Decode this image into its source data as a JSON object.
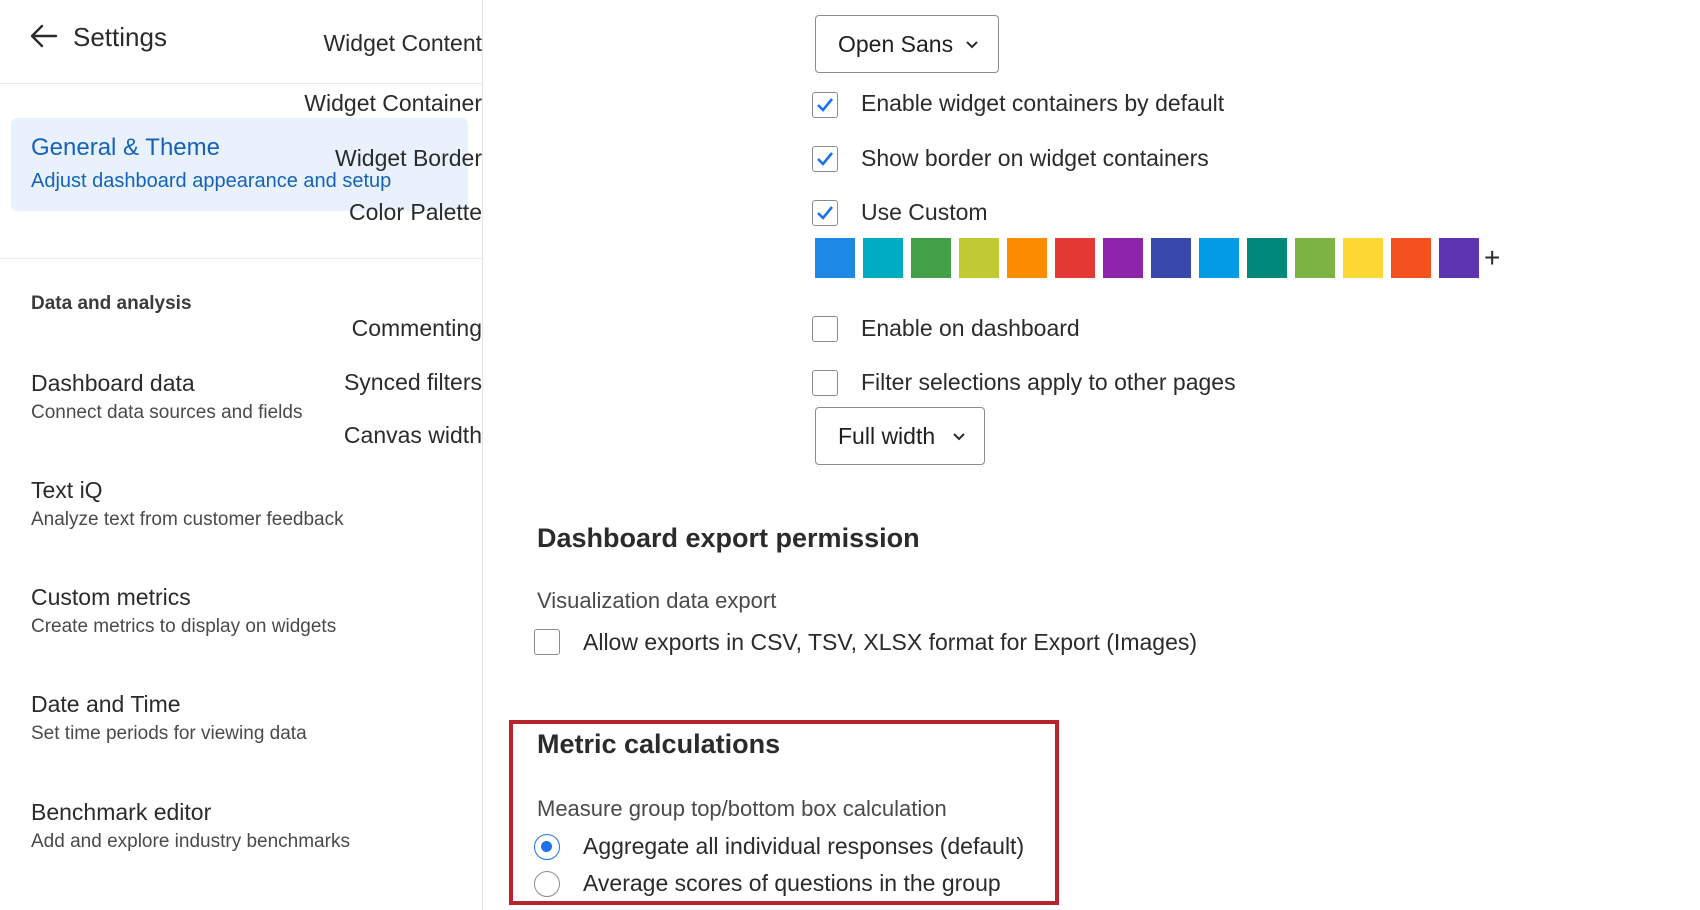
{
  "sidebar": {
    "title": "Settings",
    "active": {
      "label": "General & Theme",
      "description": "Adjust dashboard appearance and setup"
    },
    "section_label": "Data and analysis",
    "items": [
      {
        "label": "Dashboard data",
        "description": "Connect data sources and fields"
      },
      {
        "label": "Text iQ",
        "description": "Analyze text from customer feedback"
      },
      {
        "label": "Custom metrics",
        "description": "Create metrics to display on widgets"
      },
      {
        "label": "Date and Time",
        "description": "Set time periods for viewing data"
      },
      {
        "label": "Benchmark editor",
        "description": "Add and explore industry benchmarks"
      }
    ]
  },
  "theme": {
    "widget_content": {
      "label": "Widget Content",
      "value": "Open Sans"
    },
    "widget_container": {
      "label": "Widget Container",
      "text": "Enable widget containers by default",
      "checked": true
    },
    "widget_border": {
      "label": "Widget Border",
      "text": "Show border on widget containers",
      "checked": true
    },
    "color_palette": {
      "label": "Color Palette",
      "text": "Use Custom",
      "checked": true,
      "colors": [
        "#1e88e5",
        "#00acc1",
        "#43a047",
        "#c0ca33",
        "#fb8c00",
        "#e53935",
        "#8e24aa",
        "#3949ab",
        "#039be5",
        "#00897b",
        "#7cb342",
        "#fdd835",
        "#f4511e",
        "#5e35b1"
      ],
      "add_label": "+"
    },
    "commenting": {
      "label": "Commenting",
      "text": "Enable on dashboard",
      "checked": false
    },
    "synced_filters": {
      "label": "Synced filters",
      "text": "Filter selections apply to other pages",
      "checked": false
    },
    "canvas_width": {
      "label": "Canvas width",
      "value": "Full width"
    }
  },
  "export": {
    "heading": "Dashboard export permission",
    "sub": "Visualization data export",
    "option": {
      "text": "Allow exports in CSV, TSV, XLSX format for Export (Images)",
      "checked": false
    }
  },
  "metrics": {
    "heading": "Metric calculations",
    "sub": "Measure group top/bottom box calculation",
    "options": [
      {
        "text": "Aggregate all individual responses (default)",
        "selected": true
      },
      {
        "text": "Average scores of questions in the group",
        "selected": false
      }
    ]
  }
}
